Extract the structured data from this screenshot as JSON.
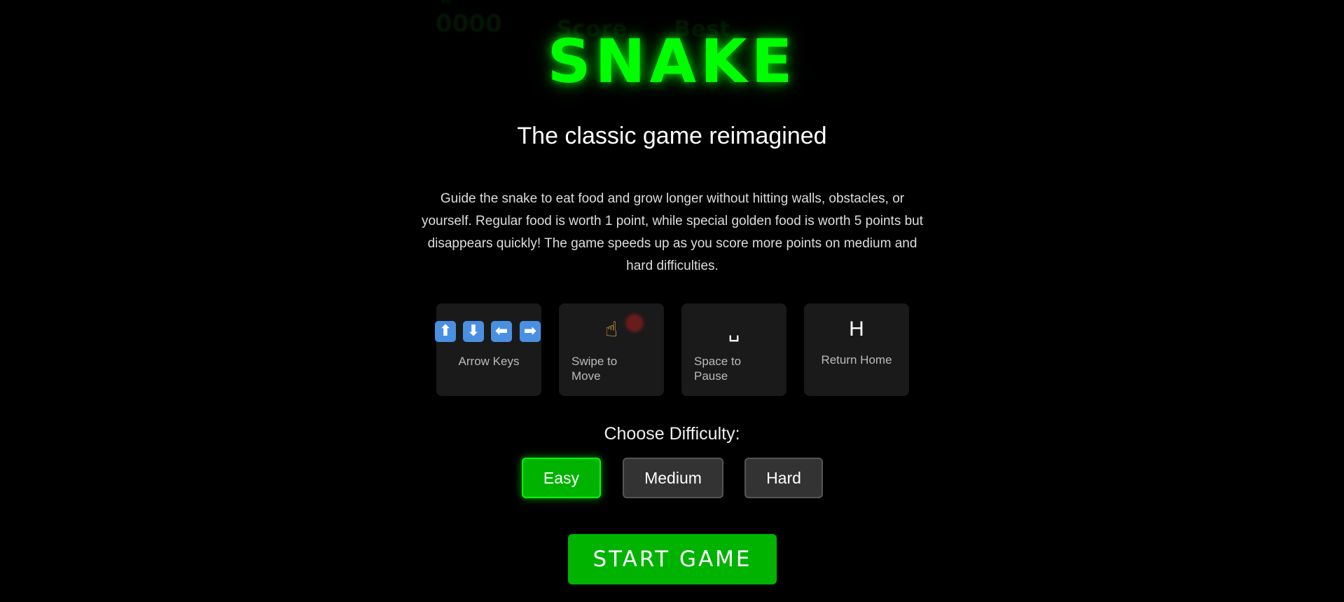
{
  "background_overlay": {
    "label": "HI",
    "value": "0000",
    "score_label": "Score",
    "best_label": "Best"
  },
  "menu": {
    "title": "SNAKE",
    "subtitle": "The classic game reimagined",
    "description": "Guide the snake to eat food and grow longer without hitting walls, obstacles, or yourself. Regular food is worth 1 point, while special golden food is worth 5 points but disappears quickly! The game speeds up as you score more points on medium and hard difficulties."
  },
  "controls": [
    {
      "icon": "arrow-keys-icon",
      "label": "Arrow Keys",
      "glyphs": [
        "⬆",
        "⬇",
        "⬅",
        "➡"
      ]
    },
    {
      "icon": "pointing-hand-icon",
      "label": "Swipe to Move",
      "glyph": "☝"
    },
    {
      "icon": "space-key-icon",
      "label": "Space to Pause",
      "glyph": "␣"
    },
    {
      "icon": "h-key-icon",
      "label": "Return Home",
      "glyph": "H"
    }
  ],
  "difficulty": {
    "label": "Choose Difficulty:",
    "options": [
      "Easy",
      "Medium",
      "Hard"
    ],
    "selected": "Easy"
  },
  "start_button": {
    "label": "START GAME"
  },
  "colors": {
    "background": "#000000",
    "accent": "#00ff00",
    "button_green": "#00b300",
    "card_bg": "#1a1a1a",
    "button_gray": "#333333",
    "arrow_key_blue": "#4a90e2"
  }
}
